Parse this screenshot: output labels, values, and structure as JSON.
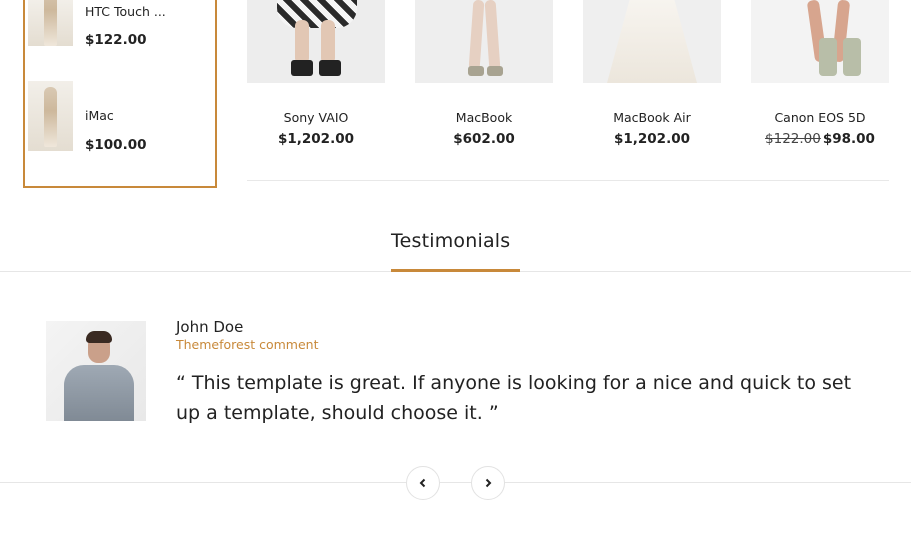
{
  "sidebar": {
    "items": [
      {
        "name": "HTC Touch ...",
        "price": "$122.00"
      },
      {
        "name": "iMac",
        "price": "$100.00"
      }
    ]
  },
  "products": [
    {
      "name": "Sony VAIO",
      "price": "$1,202.00"
    },
    {
      "name": "MacBook",
      "price": "$602.00"
    },
    {
      "name": "MacBook Air",
      "price": "$1,202.00"
    },
    {
      "name": "Canon EOS 5D",
      "old_price": "$122.00",
      "price": "$98.00"
    }
  ],
  "testimonials": {
    "title": "Testimonials",
    "author": "John Doe",
    "role": "Themeforest comment",
    "quote": "“ This template is great. If anyone is looking for a nice and quick to set up a template, should choose it. ”",
    "prev_icon": "chevron-left-icon",
    "next_icon": "chevron-right-icon"
  },
  "colors": {
    "accent": "#c8893a",
    "text": "#222222",
    "divider": "#e6e6e6"
  }
}
